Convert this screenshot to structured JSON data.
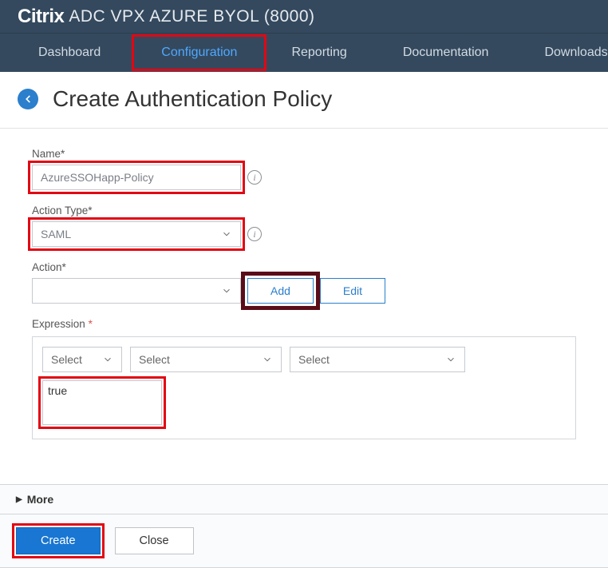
{
  "header": {
    "brand": "Citrix",
    "subtitle": "ADC VPX AZURE BYOL (8000)"
  },
  "nav": {
    "items": [
      {
        "label": "Dashboard",
        "active": false
      },
      {
        "label": "Configuration",
        "active": true
      },
      {
        "label": "Reporting",
        "active": false
      },
      {
        "label": "Documentation",
        "active": false
      },
      {
        "label": "Downloads",
        "active": false
      }
    ]
  },
  "page": {
    "title": "Create Authentication Policy"
  },
  "form": {
    "name": {
      "label": "Name*",
      "value": "AzureSSOHapp-Policy"
    },
    "actionType": {
      "label": "Action Type*",
      "value": "SAML"
    },
    "action": {
      "label": "Action*",
      "value": "",
      "addLabel": "Add",
      "editLabel": "Edit"
    },
    "expression": {
      "label": "Expression",
      "selects": [
        "Select",
        "Select",
        "Select"
      ],
      "value": "true"
    },
    "moreLabel": "More",
    "createLabel": "Create",
    "closeLabel": "Close"
  }
}
